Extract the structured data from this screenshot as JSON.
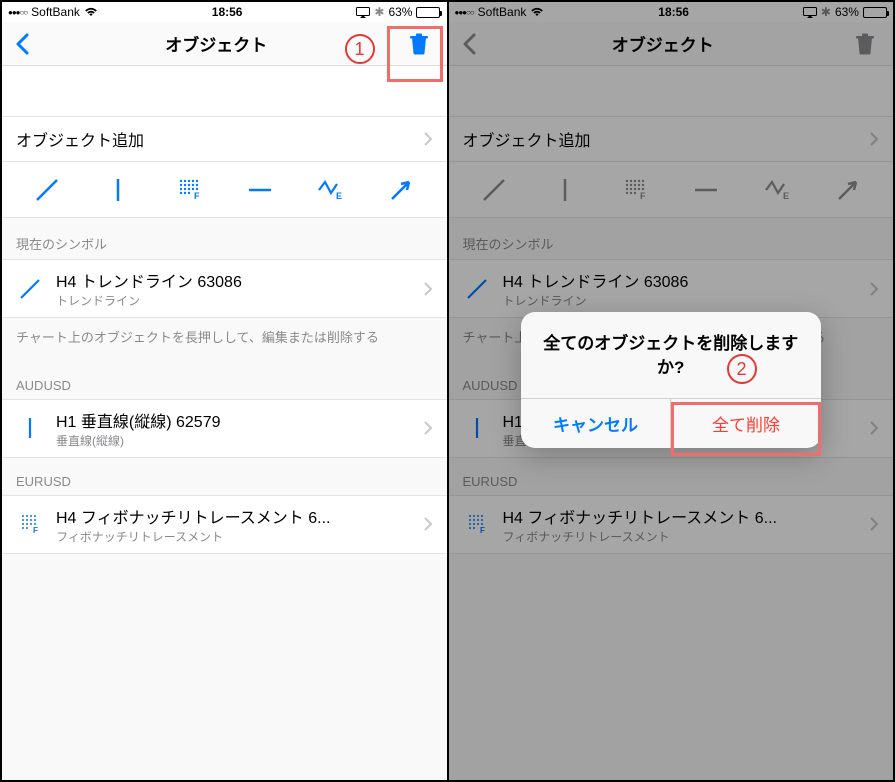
{
  "status": {
    "carrier": "SoftBank",
    "time": "18:56",
    "battery_pct": "63%"
  },
  "nav": {
    "title": "オブジェクト"
  },
  "colors": {
    "tint": "#007aff",
    "grey_tint": "#8e8e93"
  },
  "content": {
    "add_label": "オブジェクト追加",
    "tools": [
      "trendline-icon",
      "vertical-line-icon",
      "fibo-grid-icon",
      "horiz-line-icon",
      "zigzag-e-icon",
      "arrow-icon"
    ],
    "section_current": "現在のシンボル",
    "help_text": "チャート上のオブジェクトを長押しして、編集または削除する",
    "objects": [
      {
        "icon": "trendline-icon",
        "title": "H4 トレンドライン 63086",
        "sub": "トレンドライン"
      }
    ],
    "groups": [
      {
        "symbol": "AUDUSD",
        "icon": "vertical-line-icon",
        "title": "H1 垂直線(縦線) 62579",
        "sub": "垂直線(縦線)"
      },
      {
        "symbol": "EURUSD",
        "icon": "fibo-grid-icon",
        "title": "H4 フィボナッチリトレースメント 6...",
        "sub": "フィボナッチリトレースメント"
      }
    ]
  },
  "alert": {
    "title": "全てのオブジェクトを削除しますか?",
    "cancel": "キャンセル",
    "destructive": "全て削除"
  },
  "annotations": {
    "one": "1",
    "two": "2"
  }
}
